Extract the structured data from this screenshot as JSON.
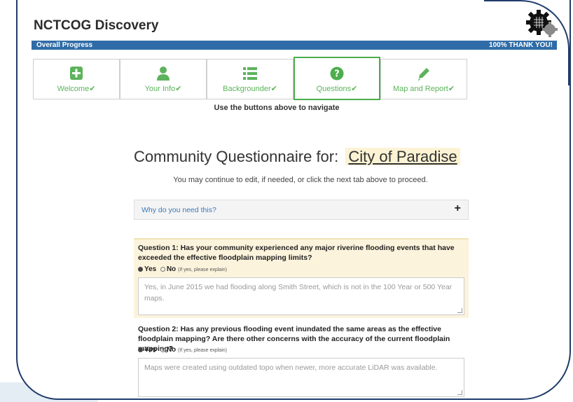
{
  "app": {
    "title": "NCTCOG Discovery"
  },
  "progress": {
    "label": "Overall Progress",
    "status": "100% THANK YOU!",
    "percent": 100
  },
  "tabs": [
    {
      "label": "Welcome",
      "icon": "plus-square-icon",
      "done": true,
      "active": false
    },
    {
      "label": "Your Info",
      "icon": "user-icon",
      "done": true,
      "active": false
    },
    {
      "label": "Backgrounder",
      "icon": "list-icon",
      "done": true,
      "active": false
    },
    {
      "label": "Questions",
      "icon": "question-circle-icon",
      "done": true,
      "active": true
    },
    {
      "label": "Map and Report",
      "icon": "pencil-icon",
      "done": true,
      "active": false
    }
  ],
  "nav_hint": "Use the buttons above to navigate",
  "main": {
    "heading": "Community Questionnaire for:",
    "city": "City of Paradise",
    "subline": "You may continue to edit, if needed, or click the next tab above to proceed.",
    "why_label": "Why do you need this?"
  },
  "questions": [
    {
      "text": "Question 1: Has your community experienced any major riverine flooding events that have exceeded the effective floodplain mapping limits?",
      "yes": "Yes",
      "no": "No",
      "note": "(If yes, please explain)",
      "selected": "Yes",
      "answer": "Yes, in June 2015 we had flooding along Smith Street, which is not in the 100 Year or 500 Year maps."
    },
    {
      "text": "Question 2: Has any previous flooding event inundated the same areas as the effective floodplain mapping? Are there other concerns with the accuracy of the current floodplain mapping?",
      "yes": "Yes",
      "no": "No",
      "note": "(If yes, please explain)",
      "selected": "Yes",
      "answer": "Maps were created using outdated topo when newer, more accurate LiDAR was available."
    }
  ],
  "colors": {
    "accent": "#5cb35c",
    "progress": "#2f6ca7",
    "highlight": "#fcf3dc",
    "frame": "#1f3c6b"
  }
}
